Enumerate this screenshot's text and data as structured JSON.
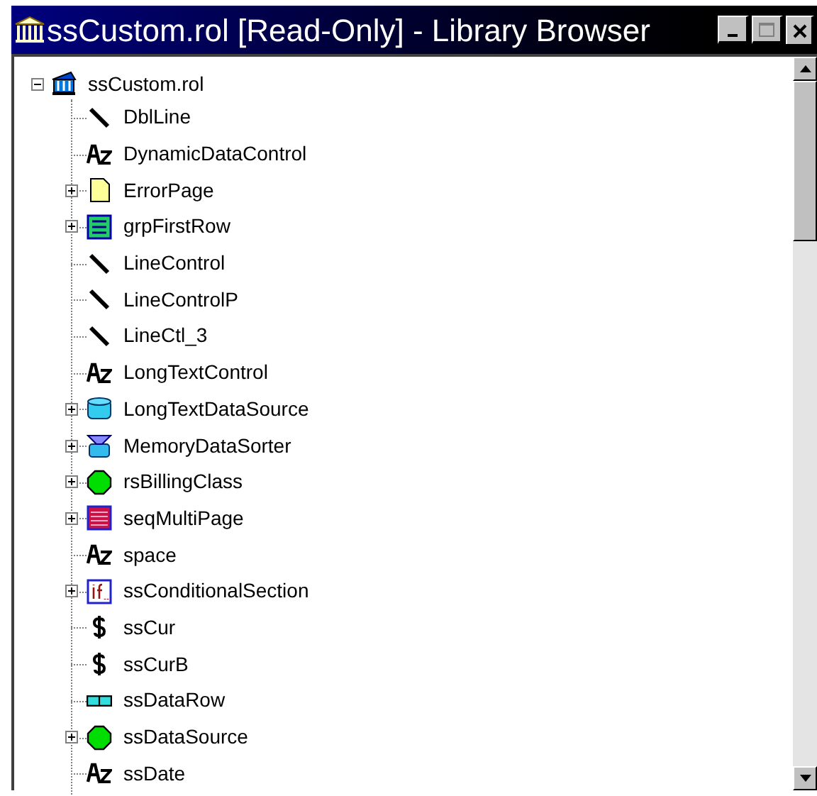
{
  "window": {
    "title": "ssCustom.rol [Read-Only] - Library Browser"
  },
  "tree": {
    "root": {
      "label": "ssCustom.rol",
      "expanded": true,
      "children": [
        {
          "label": "DblLine",
          "kind": "line",
          "has_children": false
        },
        {
          "label": "DynamicDataControl",
          "kind": "text",
          "has_children": false
        },
        {
          "label": "ErrorPage",
          "kind": "page",
          "has_children": true
        },
        {
          "label": "grpFirstRow",
          "kind": "group",
          "has_children": true
        },
        {
          "label": "LineControl",
          "kind": "line",
          "has_children": false
        },
        {
          "label": "LineControlP",
          "kind": "line",
          "has_children": false
        },
        {
          "label": "LineCtl_3",
          "kind": "line",
          "has_children": false
        },
        {
          "label": "LongTextControl",
          "kind": "text",
          "has_children": false
        },
        {
          "label": "LongTextDataSource",
          "kind": "sql",
          "has_children": true
        },
        {
          "label": "MemoryDataSorter",
          "kind": "sorter",
          "has_children": true
        },
        {
          "label": "rsBillingClass",
          "kind": "class",
          "has_children": true
        },
        {
          "label": "seqMultiPage",
          "kind": "sequence",
          "has_children": true
        },
        {
          "label": "space",
          "kind": "text",
          "has_children": false
        },
        {
          "label": "ssConditionalSection",
          "kind": "conditional",
          "has_children": true
        },
        {
          "label": "ssCur",
          "kind": "currency",
          "has_children": false
        },
        {
          "label": "ssCurB",
          "kind": "currency",
          "has_children": false
        },
        {
          "label": "ssDataRow",
          "kind": "datarow",
          "has_children": false
        },
        {
          "label": "ssDataSource",
          "kind": "class",
          "has_children": true
        },
        {
          "label": "ssDate",
          "kind": "text",
          "has_children": false
        }
      ]
    }
  }
}
